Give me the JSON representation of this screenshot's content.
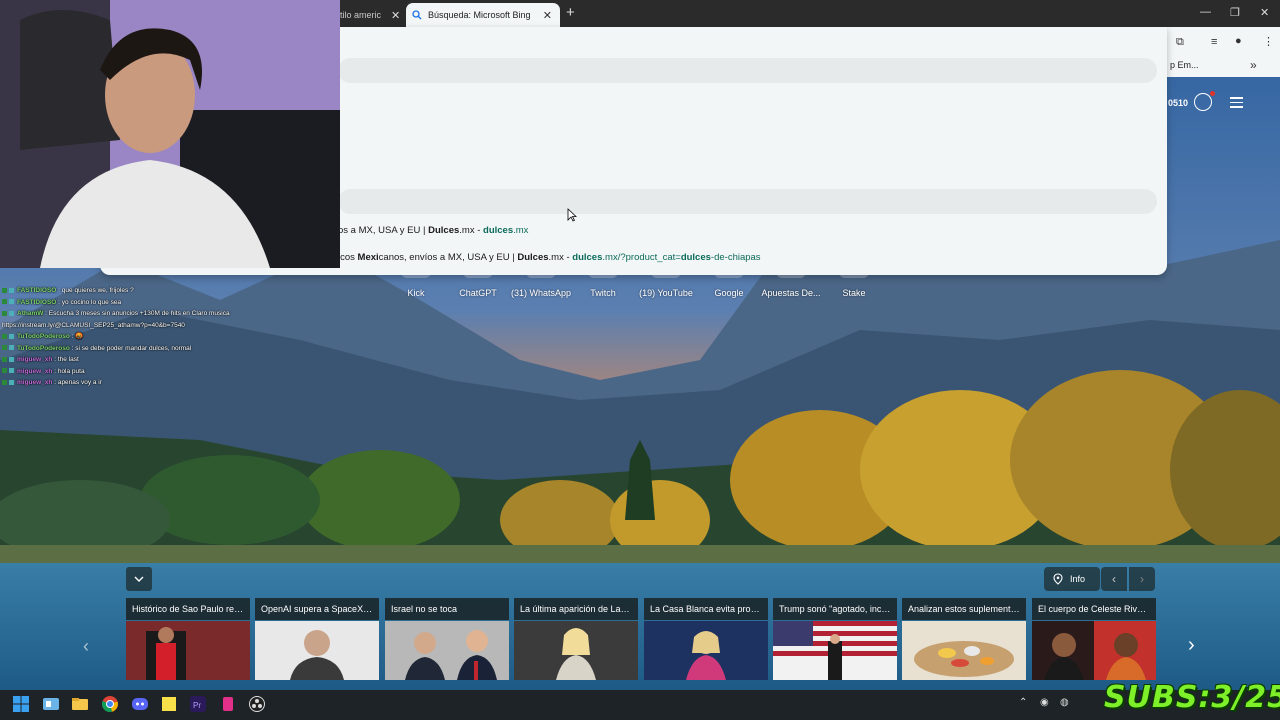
{
  "browser": {
    "tabs": [
      {
        "label": "tilo americ"
      },
      {
        "label": "Búsqueda: Microsoft Bing"
      }
    ],
    "new_tab": "+",
    "bookmark_item": "p Em...",
    "bookmark_more": "»"
  },
  "omnibox": {
    "suggestions": [
      {
        "prefix": "os a MX, USA y EU | ",
        "bold": "Dulces",
        "suffix": ".mx - ",
        "url_bold": "dulces",
        "url_rest": ".mx",
        "url_tail": "",
        "url_tail_bold": "",
        "url_end": ""
      },
      {
        "prefix": "icos ",
        "bold": "Mexi",
        "suffix_pre": "canos, envíos a MX, USA y EU | ",
        "bold2": "Dulces",
        "suffix": ".mx - ",
        "url_bold": "dulces",
        "url_rest": ".mx/?product_cat=",
        "url_tail_bold": "dulces",
        "url_end": "-de-chiapas"
      }
    ]
  },
  "bing": {
    "points": "0510",
    "quick_links": [
      "Kick",
      "ChatGPT",
      "(31) WhatsApp",
      "Twitch",
      "(19) YouTube",
      "Google",
      "Apuestas De...",
      "Stake"
    ],
    "info_label": "Info",
    "news": [
      {
        "title": "Histórico de Sao Paulo resc..."
      },
      {
        "title": "OpenAI supera a SpaceX d..."
      },
      {
        "title": "Israel no se toca"
      },
      {
        "title": "La última aparición de Lad..."
      },
      {
        "title": "La Casa Blanca evita pronu..."
      },
      {
        "title": "Trump sonó \"agotado, inco..."
      },
      {
        "title": "Analizan estos suplemento..."
      },
      {
        "title": "El cuerpo de Celeste Rivas l..."
      }
    ]
  },
  "chat": [
    {
      "user": "FASTIDIOSO",
      "msg": " : que quieres we, frijoles ?",
      "color": "#7ad36b"
    },
    {
      "user": "FASTIDIOSO",
      "msg": " : yo cocino lo que sea",
      "color": "#7ad36b"
    },
    {
      "user": "AthamW",
      "msg": " : Escucha 3 meses sin anuncios +130M de hits en Claro musica",
      "color": "#7ad36b"
    },
    {
      "user": "",
      "msg": "https://instream.ly/@CLAMUSI_SEP25_athamw?p=40&b=7540",
      "color": "#fff"
    },
    {
      "user": "TuTodoPoderoso",
      "msg": " : 🤬",
      "color": "#7ad36b"
    },
    {
      "user": "TuTodoPoderoso",
      "msg": " : si se debe poder mandar dulces, normal",
      "color": "#7ad36b"
    },
    {
      "user": "miguew_xh",
      "msg": " : the last",
      "color": "#c06bd8"
    },
    {
      "user": "miguew_xh",
      "msg": " : hola puta",
      "color": "#c06bd8"
    },
    {
      "user": "miguew_xh",
      "msg": " : apenas voy a ir",
      "color": "#c06bd8"
    }
  ],
  "overlay": {
    "subs": "SUBS:3/25"
  },
  "colors": {
    "chrome_dark": "#2b2b2b",
    "chrome_light": "#f2f6f6",
    "url_green": "#0c6b5b",
    "subs_green": "#7ef02a"
  }
}
